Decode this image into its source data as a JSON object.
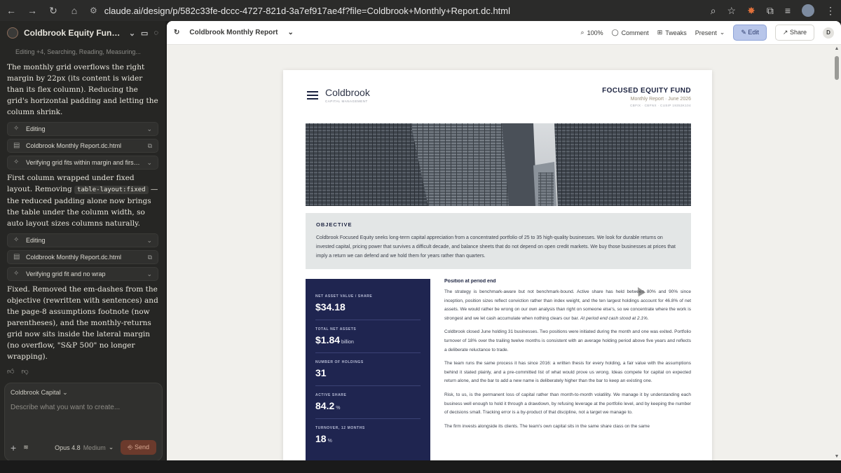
{
  "browser": {
    "url": "claude.ai/design/p/582c33fe-dccc-4727-821d-3a7ef917ae4f?file=Coldbrook+Monthly+Report.dc.html"
  },
  "sidebar": {
    "project_title": "Coldbrook Equity Fund Re...",
    "status_line": "Editing +4, Searching, Reading, Measuring...",
    "messages": [
      "The monthly grid overflows the right margin by 22px (its content is wider than its flex column). Reducing the grid's horizontal padding and letting the column shrink.",
      "Fixed. Removed the em-dashes from the objective (rewritten with sentences) and the page-8 assumptions footnote (now parentheses), and the monthly-returns grid now sits inside the lateral margin (no overflow, \"S&P 500\" no longer wrapping)."
    ],
    "msg2_pre": "First column wrapped under fixed layout. Removing ",
    "msg2_code": "table-layout:fixed",
    "msg2_post": " — the reduced padding alone now brings the table under the column width, so auto layout sizes columns naturally.",
    "pills": [
      {
        "label": "Editing"
      },
      {
        "label": "Coldbrook Monthly Report.dc.html"
      },
      {
        "label": "Verifying grid fits within margin and first c..."
      },
      {
        "label": "Editing"
      },
      {
        "label": "Coldbrook Monthly Report.dc.html"
      },
      {
        "label": "Verifying grid fit and no wrap"
      }
    ]
  },
  "composer": {
    "project": "Coldbrook Capital",
    "placeholder": "Describe what you want to create...",
    "model": "Opus 4.8",
    "tier": "Medium",
    "send": "Send"
  },
  "toolbar": {
    "doc_title": "Coldbrook Monthly Report",
    "zoom": "100%",
    "comment": "Comment",
    "tweaks": "Tweaks",
    "present": "Present",
    "edit": "Edit",
    "share": "Share",
    "user_initial": "D"
  },
  "report": {
    "brand": "Coldbrook",
    "brand_sub": "CAPITAL MANAGEMENT",
    "fund_name": "FOCUSED EQUITY FUND",
    "fund_sub": "Monthly Report · June 2026",
    "tickers": "CBFIX · CBFNX · CUSIP 19353K104",
    "objective_heading": "OBJECTIVE",
    "objective_text": "Coldbrook Focused Equity seeks long-term capital appreciation from a concentrated portfolio of 25 to 35 high-quality businesses. We look for durable returns on invested capital, pricing power that survives a difficult decade, and balance sheets that do not depend on open credit markets. We buy those businesses at prices that imply a return we can defend and we hold them for years rather than quarters.",
    "stats": [
      {
        "label": "NET ASSET VALUE / SHARE",
        "value": "$34.18",
        "unit": ""
      },
      {
        "label": "TOTAL NET ASSETS",
        "value": "$1.84",
        "unit": "billion"
      },
      {
        "label": "NUMBER OF HOLDINGS",
        "value": "31",
        "unit": ""
      },
      {
        "label": "ACTIVE SHARE",
        "value": "84.2",
        "unit": "%"
      },
      {
        "label": "TURNOVER, 12 MONTHS",
        "value": "18",
        "unit": "%"
      }
    ],
    "body_heading": "Position at period end",
    "p1_pre": "The strategy is benchmark-aware but not benchmark-bound. Active share has held between 80% and 90% since inception, position sizes reflect conviction rather than index weight, and the ten largest holdings account for 46.8% of net assets. We would rather be wrong on our own analysis than right on someone else's, so we concentrate where the work is strongest and we let cash accumulate when nothing clears our bar. ",
    "p1_em": "At period end cash stood at 2.1%.",
    "p2": "Coldbrook closed June holding 31 businesses. Two positions were initiated during the month and one was exited. Portfolio turnover of 18% over the trailing twelve months is consistent with an average holding period above five years and reflects a deliberate reluctance to trade.",
    "p3": "The team runs the same process it has since 2016: a written thesis for every holding, a fair value with the assumptions behind it stated plainly, and a pre-committed list of what would prove us wrong. Ideas compete for capital on expected return alone, and the bar to add a new name is deliberately higher than the bar to keep an existing one.",
    "p4": "Risk, to us, is the permanent loss of capital rather than month-to-month volatility. We manage it by understanding each business well enough to hold it through a drawdown, by refusing leverage at the portfolio level, and by keeping the number of decisions small. Tracking error is a by-product of that discipline, not a target we manage to.",
    "p5": "The firm invests alongside its clients. The team's own capital sits in the same share class on the same"
  },
  "colors": {
    "navy": "#1f2550",
    "edit_accent": "#b8c6ea",
    "send": "#6b3a2c"
  },
  "icons": [
    "back-icon",
    "forward-icon",
    "reload-icon",
    "home-icon",
    "search-icon",
    "star-icon",
    "menu-icon",
    "comment-icon",
    "tweaks-icon",
    "pencil-icon",
    "share-icon"
  ]
}
